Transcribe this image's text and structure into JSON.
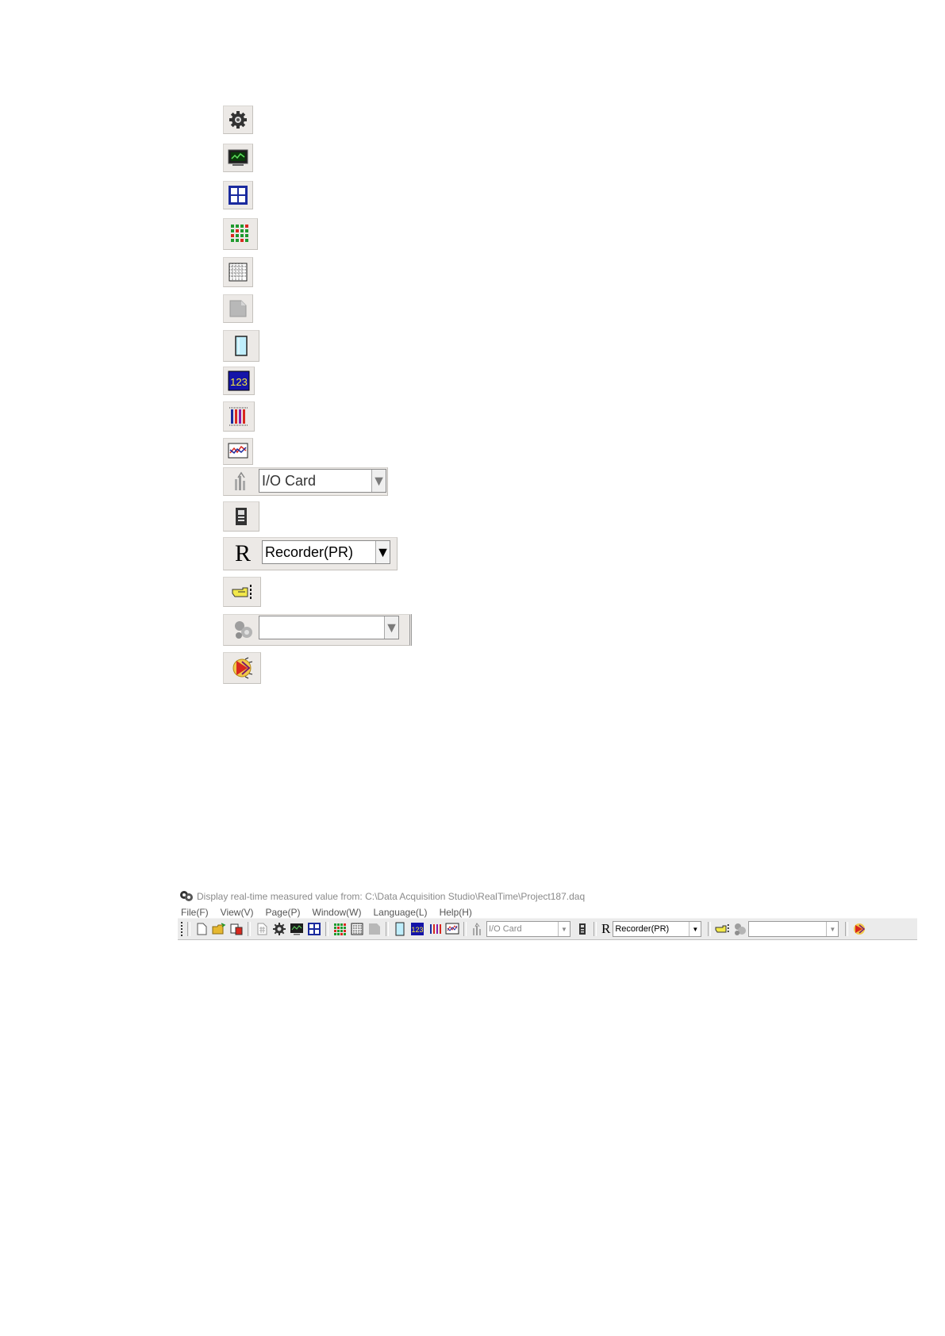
{
  "vertical_toolbar": {
    "items": [
      {
        "name": "setup-gear-icon"
      },
      {
        "name": "monitor-icon"
      },
      {
        "name": "window-grid-icon"
      },
      {
        "name": "color-dots-grid-icon"
      },
      {
        "name": "dotted-grid-icon"
      },
      {
        "name": "page-icon"
      },
      {
        "name": "column-bar-icon"
      },
      {
        "name": "digital-display-icon"
      },
      {
        "name": "bar-graph-icon"
      },
      {
        "name": "trend-chart-icon"
      }
    ],
    "io_card_combo": "I/O Card",
    "recorder_letter": "R",
    "recorder_combo": "Recorder(PR)",
    "device_combo": ""
  },
  "window": {
    "title": "Display real-time measured value from: C:\\Data Acquisition Studio\\RealTime\\Project187.daq"
  },
  "menu": {
    "items": [
      "File(F)",
      "View(V)",
      "Page(P)",
      "Window(W)",
      "Language(L)",
      "Help(H)"
    ]
  },
  "toolbar": {
    "io_card_combo": "I/O Card",
    "recorder_letter": "R",
    "recorder_combo": "Recorder(PR)",
    "device_combo": ""
  },
  "colors": {
    "toolbar_bg": "#ebebeb",
    "accent_blue": "#1a2a9e",
    "accent_green": "#1f9a2e",
    "accent_red": "#d8281e"
  }
}
